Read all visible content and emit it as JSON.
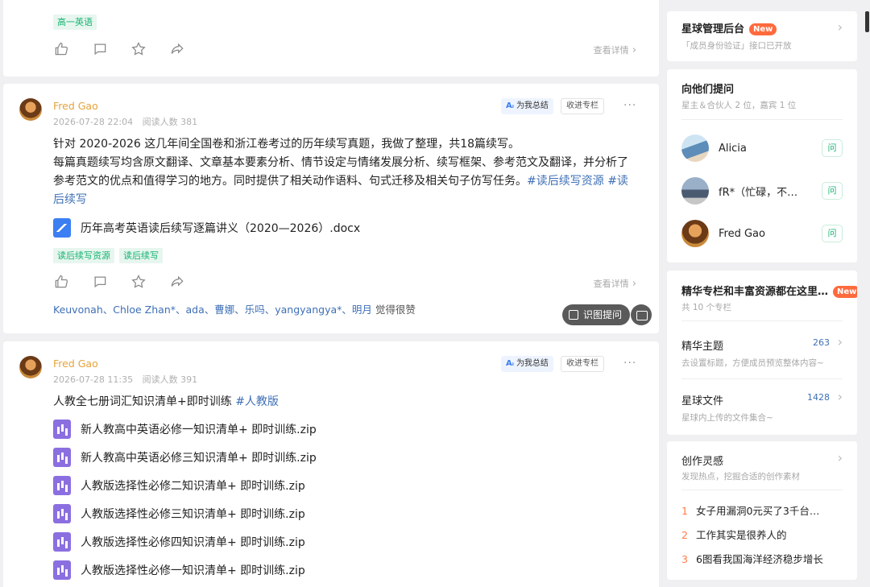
{
  "post1": {
    "tags": [
      "高一英语"
    ],
    "detail_label": "查看详情"
  },
  "post2": {
    "author": "Fred Gao",
    "date": "2026-07-28 22:04",
    "reads": "阅读人数 381",
    "ai_label": "为我总结",
    "ai_icon": "Aᵢ",
    "collect_label": "收进专栏",
    "more_label": "···",
    "text_line1": "针对 2020-2026 这几年间全国卷和浙江卷考过的历年续写真题，我做了整理，共18篇续写。",
    "text_line2": "每篇真题续写均含原文翻译、文章基本要素分析、情节设定与情绪发展分析、续写框架、参考范文及翻译，并分析了参考范文的优点和值得学习的地方。同时提供了相关动作语料、句式迁移及相关句子仿写任务。",
    "hashtag1": "#读后续写资源",
    "hashtag2": "#读后续写",
    "file": "历年高考英语读后续写逐篇讲义（2020—2026）.docx",
    "tags": [
      "读后续写资源",
      "读后续写"
    ],
    "detail_label": "查看详情",
    "likers": "Keuvonah、Chloe Zhan*、ada、曹娜、乐吗、yangyangya*、明月",
    "likes_suffix": "觉得很赞"
  },
  "floating": {
    "image_ask_label": "识图提问"
  },
  "post3": {
    "author": "Fred Gao",
    "date": "2026-07-28 11:35",
    "reads": "阅读人数 391",
    "ai_label": "为我总结",
    "ai_icon": "Aᵢ",
    "collect_label": "收进专栏",
    "more_label": "···",
    "text": "人教全七册词汇知识清单+即时训练",
    "hashtag": "#人教版",
    "files": [
      "新人教高中英语必修一知识清单+ 即时训练.zip",
      "新人教高中英语必修三知识清单+ 即时训练.zip",
      "人教版选择性必修二知识清单+ 即时训练.zip",
      "人教版选择性必修三知识清单+ 即时训练.zip",
      "人教版选择性必修四知识清单+ 即时训练.zip",
      "人教版选择性必修一知识清单+ 即时训练.zip"
    ]
  },
  "sidebar": {
    "admin": {
      "title": "星球管理后台",
      "badge": "New",
      "sub": "「成员身份验证」接口已开放"
    },
    "ask": {
      "title": "向他们提问",
      "sub": "星主＆合伙人 2 位，嘉宾 1 位",
      "ask_label": "问",
      "people": [
        "Alicia",
        "fR*（忙碌，不…",
        "Fred Gao"
      ]
    },
    "columns": {
      "title": "精华专栏和丰富资源都在这里…",
      "badge": "New",
      "sub": "共 10 个专栏",
      "essence_title": "精华主题",
      "essence_count": "263",
      "essence_sub": "去设置标题，方便成员预览整体内容~",
      "files_title": "星球文件",
      "files_count": "1428",
      "files_sub": "星球内上传的文件集合~"
    },
    "inspiration": {
      "title": "创作灵感",
      "sub": "发现热点，挖掘合适的创作素材",
      "items": [
        {
          "rank": "1",
          "text": "女子用漏洞0元买了3千台…"
        },
        {
          "rank": "2",
          "text": "工作其实是很养人的"
        },
        {
          "rank": "3",
          "text": "6图看我国海洋经济稳步增长"
        }
      ]
    }
  },
  "colors": {
    "author": "#e6a23c",
    "tag_green": "#15b371",
    "link_blue": "#3e6fb5",
    "badge_orange": "#ff6a3d"
  }
}
